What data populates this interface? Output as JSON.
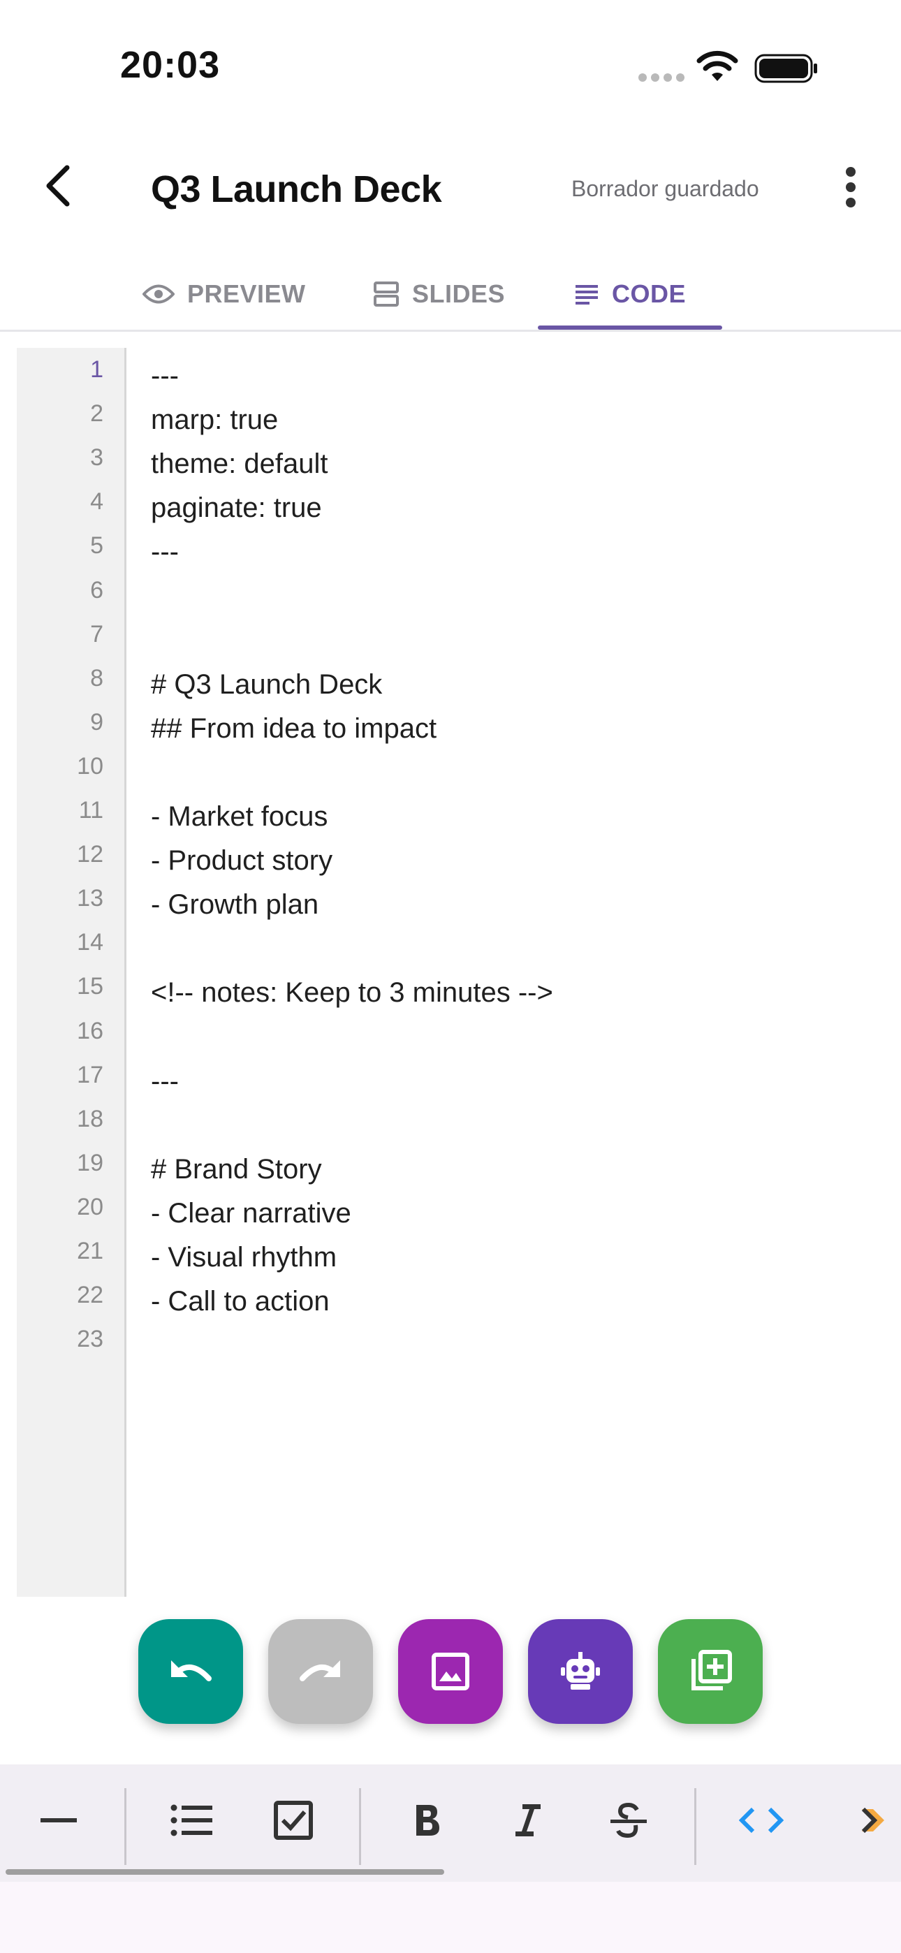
{
  "status_bar": {
    "time": "20:03"
  },
  "app_bar": {
    "title": "Q3 Launch Deck",
    "draft_status": "Borrador guardado"
  },
  "tabs": [
    {
      "label": "PREVIEW",
      "icon": "eye-icon",
      "active": false
    },
    {
      "label": "SLIDES",
      "icon": "slides-icon",
      "active": false
    },
    {
      "label": "CODE",
      "icon": "notes-icon",
      "active": true
    }
  ],
  "editor": {
    "active_line": 1,
    "line_numbers": [
      "1",
      "2",
      "3",
      "4",
      "5",
      "6",
      "7",
      "8",
      "9",
      "10",
      "11",
      "12",
      "13",
      "14",
      "15",
      "16",
      "17",
      "18",
      "19",
      "20",
      "21",
      "22",
      "23"
    ],
    "lines": [
      "---",
      "marp: true",
      "theme: default",
      "paginate: true",
      "---",
      "",
      "",
      "# Q3 Launch Deck",
      "## From idea to impact",
      "",
      "- Market focus",
      "- Product story",
      "- Growth plan",
      "",
      "<!-- notes: Keep to 3 minutes -->",
      "",
      "---",
      "",
      "# Brand Story",
      "- Clear narrative",
      "- Visual rhythm",
      "- Call to action",
      ""
    ]
  },
  "fabs": [
    {
      "name": "undo",
      "icon": "undo-icon",
      "color": "#009688",
      "enabled": true
    },
    {
      "name": "redo",
      "icon": "redo-icon",
      "color": "#bdbdbd",
      "enabled": false
    },
    {
      "name": "image",
      "icon": "image-icon",
      "color": "#9c27b0",
      "enabled": true
    },
    {
      "name": "bot",
      "icon": "robot-icon",
      "color": "#673ab7",
      "enabled": true
    },
    {
      "name": "add-slide",
      "icon": "add-slide-icon",
      "color": "#4caf50",
      "enabled": true
    }
  ],
  "format_toolbar": {
    "tools": [
      "horizontal-rule-icon",
      "bulleted-list-icon",
      "checklist-icon",
      "bold-icon",
      "italic-icon",
      "strikethrough-icon",
      "code-icon",
      "quote-icon"
    ]
  },
  "colors": {
    "accent": "#6a56a5",
    "toolbar_bg": "#f1eef4",
    "code_icon": "#2196f3",
    "quote_icon": "#f4a942"
  }
}
